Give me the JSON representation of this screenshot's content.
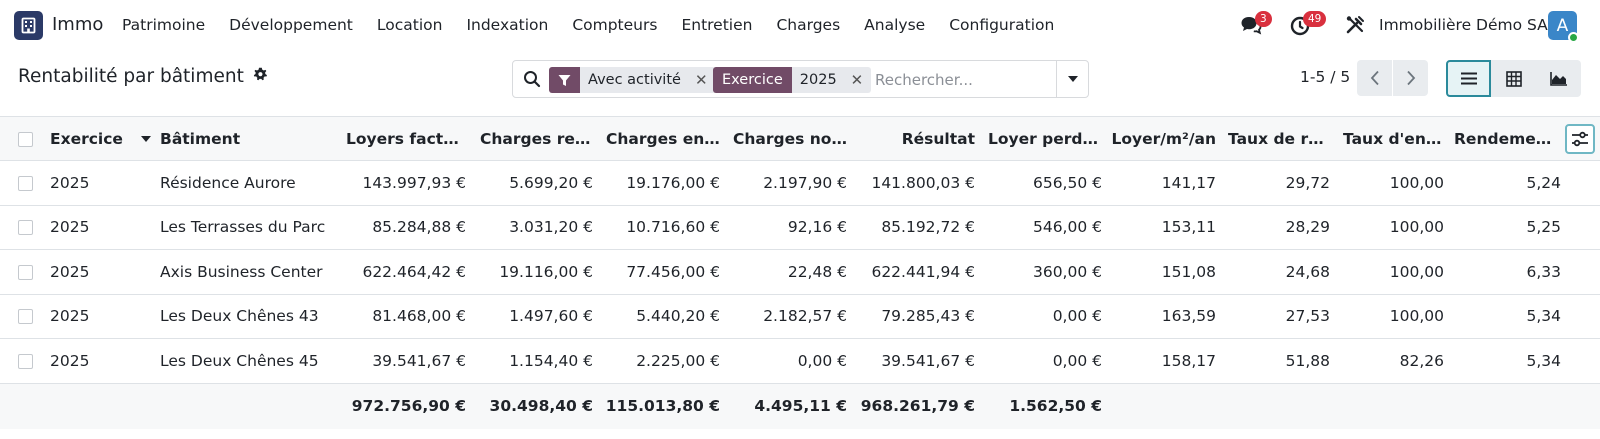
{
  "navbar": {
    "app_name": "Immo",
    "menu": [
      "Patrimoine",
      "Développement",
      "Location",
      "Indexation",
      "Compteurs",
      "Entretien",
      "Charges",
      "Analyse",
      "Configuration"
    ],
    "messages_badge": "3",
    "activities_badge": "49",
    "company": "Immobilière Démo SA",
    "avatar_letter": "A"
  },
  "control": {
    "title": "Rentabilité par bâtiment",
    "facets": {
      "filter_value": "Avec activité",
      "group_label": "Exercice",
      "group_value": "2025"
    },
    "search_placeholder": "Rechercher...",
    "pager": "1-5 / 5"
  },
  "table": {
    "columns": [
      "Exercice",
      "Bâtiment",
      "Loyers facturés",
      "Charges refac...",
      "Charges enco...",
      "Charges non r...",
      "Résultat",
      "Loyer perdu (...",
      "Loyer/m²/an",
      "Taux de réc...",
      "Taux d'enca...",
      "Rendement ..."
    ],
    "rows": [
      [
        "2025",
        "Résidence Aurore",
        "143.997,93 €",
        "5.699,20 €",
        "19.176,00 €",
        "2.197,90 €",
        "141.800,03 €",
        "656,50 €",
        "141,17",
        "29,72",
        "100,00",
        "5,24"
      ],
      [
        "2025",
        "Les Terrasses du Parc",
        "85.284,88 €",
        "3.031,20 €",
        "10.716,60 €",
        "92,16 €",
        "85.192,72 €",
        "546,00 €",
        "153,11",
        "28,29",
        "100,00",
        "5,25"
      ],
      [
        "2025",
        "Axis Business Center",
        "622.464,42 €",
        "19.116,00 €",
        "77.456,00 €",
        "22,48 €",
        "622.441,94 €",
        "360,00 €",
        "151,08",
        "24,68",
        "100,00",
        "6,33"
      ],
      [
        "2025",
        "Les Deux Chênes 43",
        "81.468,00 €",
        "1.497,60 €",
        "5.440,20 €",
        "2.182,57 €",
        "79.285,43 €",
        "0,00 €",
        "163,59",
        "27,53",
        "100,00",
        "5,34"
      ],
      [
        "2025",
        "Les Deux Chênes 45",
        "39.541,67 €",
        "1.154,40 €",
        "2.225,00 €",
        "0,00 €",
        "39.541,67 €",
        "0,00 €",
        "158,17",
        "51,88",
        "82,26",
        "5,34"
      ]
    ],
    "totals": [
      "",
      "",
      "972.756,90 €",
      "30.498,40 €",
      "115.013,80 €",
      "4.495,11 €",
      "968.261,79 €",
      "1.562,50 €",
      "",
      "",
      "",
      ""
    ]
  },
  "icons": {
    "app": "building-icon",
    "messages": "chat-icon",
    "activities": "clock-icon",
    "debug": "tools-icon",
    "settings": "gear-icon",
    "search": "search-icon",
    "filter": "funnel-icon",
    "list_view": "list-icon",
    "pivot_view": "grid-icon",
    "graph_view": "area-chart-icon",
    "column_options": "sliders-icon"
  },
  "colors": {
    "brand": "#714b67",
    "app_icon": "#2b3a67",
    "badge": "#d9303e",
    "active_view": "#2b8a9b"
  }
}
